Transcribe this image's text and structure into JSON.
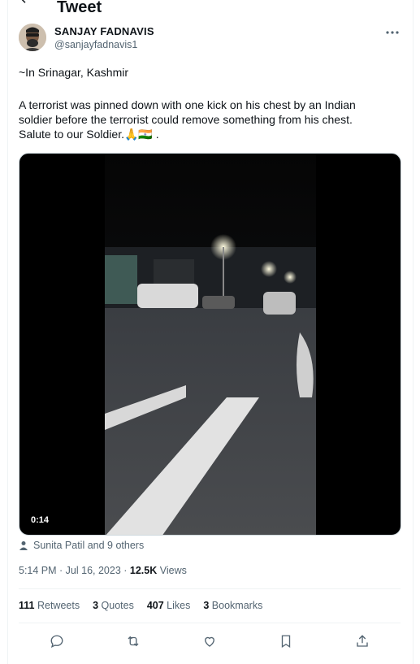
{
  "header": {
    "title": "Tweet"
  },
  "author": {
    "name": "SANJAY FADNAVIS",
    "handle": "@sanjayfadnavis1"
  },
  "tweet": {
    "location_line": "~In Srinagar, Kashmir",
    "body_line1": "A terrorist was pinned down with one kick on his chest by an Indian",
    "body_line2": "soldier before the terrorist could remove something from his chest.",
    "body_line3": "Salute to our Soldier.",
    "emoji": "🙏🇮🇳 ."
  },
  "media": {
    "duration": "0:14"
  },
  "social_context": {
    "text": "Sunita Patil and 9 others"
  },
  "meta": {
    "time_date": "5:14 PM · Jul 16, 2023 · ",
    "views_count": "12.5K",
    "views_label": " Views"
  },
  "stats": {
    "retweets_count": "111",
    "retweets_label": "Retweets",
    "quotes_count": "3",
    "quotes_label": "Quotes",
    "likes_count": "407",
    "likes_label": "Likes",
    "bookmarks_count": "3",
    "bookmarks_label": "Bookmarks"
  },
  "actions": [
    "reply-icon",
    "retweet-icon",
    "like-icon",
    "bookmark-icon",
    "share-icon"
  ],
  "colors": {
    "text_primary": "#0f1419",
    "text_secondary": "#536471",
    "divider": "#eff3f4"
  }
}
